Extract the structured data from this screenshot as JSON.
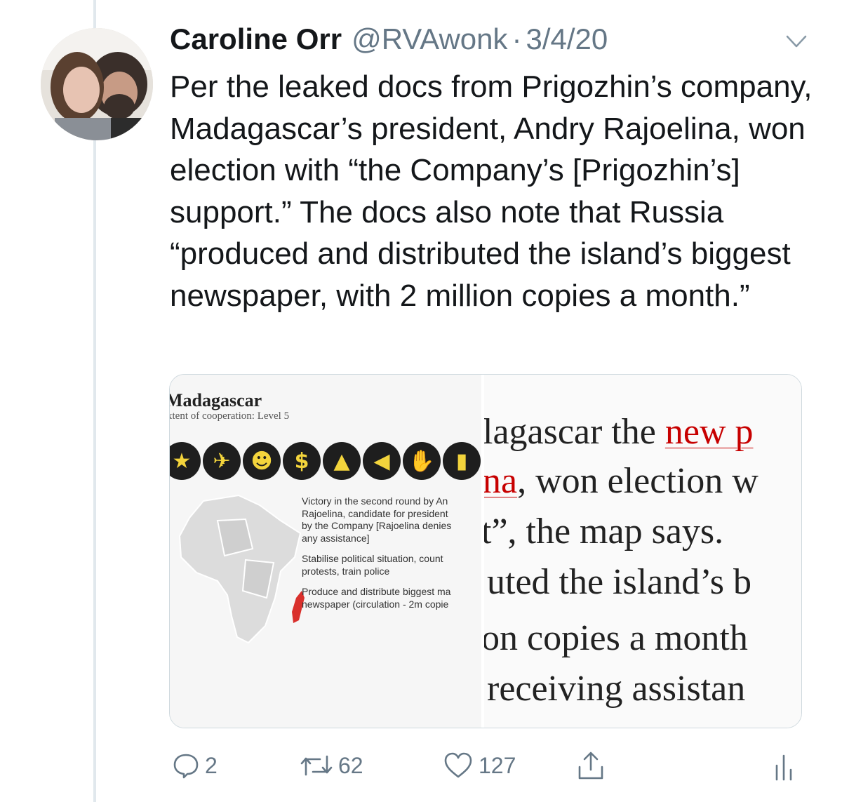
{
  "tweet": {
    "display_name": "Caroline Orr",
    "handle": "@RVAwonk",
    "separator": "·",
    "date": "3/4/20",
    "text": "Per the leaked docs from Prigozhin’s company, Madagascar’s president, Andry Rajoelina, won election with “the Company’s [Prigozhin’s] support.” The docs also note that Russia “produced and distributed the island’s biggest newspaper, with 2 million copies a month.”"
  },
  "card": {
    "left_image": {
      "title": "Madagascar",
      "subtitle": "xtent of cooperation: Level 5",
      "note1": [
        "Victory in the second round by An",
        "Rajoelina, candidate for president",
        "by the Company [Rajoelina denies",
        "any assistance]"
      ],
      "note2": [
        "Stabilise political situation, count",
        "protests, train police"
      ],
      "note3": [
        "Produce and distribute biggest ma",
        "newspaper (circulation - 2m copie"
      ],
      "icon_symbols": [
        "★",
        "✈",
        "☻",
        "$",
        "▲",
        "◀",
        "✋",
        "▮"
      ],
      "accent_color": "#f3d43c",
      "highlight_color": "#d9302c"
    },
    "right_image": {
      "line1_pre": "lagascar the ",
      "line1_link": "new p",
      "line2_link": "na",
      "line2_post": ", won election w",
      "line3": "t”, the map says. ",
      "line4": "uted the island’s b",
      "line5": "on copies a month",
      "line6": " receiving assistan",
      "link_color": "#c70000"
    }
  },
  "actions": {
    "reply_count": "2",
    "retweet_count": "62",
    "like_count": "127"
  },
  "colors": {
    "text": "#14171a",
    "secondary": "#657786",
    "border": "#cfd9de",
    "thread_line": "#e1e8ed"
  }
}
